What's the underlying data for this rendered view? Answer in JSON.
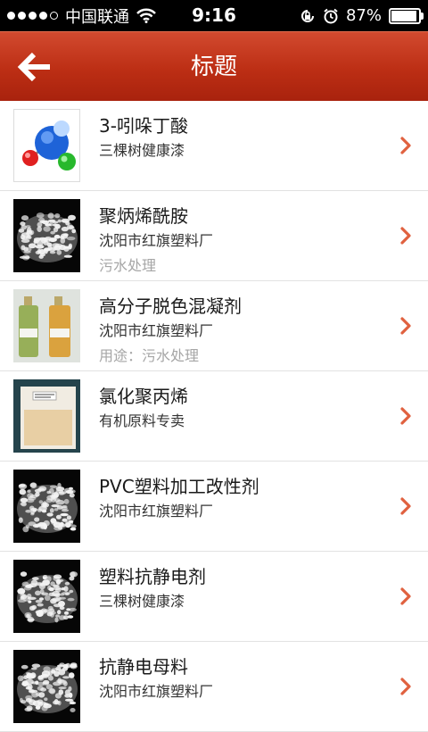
{
  "status_bar": {
    "carrier": "中国联通",
    "time": "9:16",
    "battery": "87%",
    "battery_level": 0.87,
    "icons": [
      "signal-icon",
      "wifi-icon",
      "rotation-lock-icon",
      "alarm-icon",
      "battery-icon"
    ]
  },
  "header": {
    "title": "标题",
    "back_icon": "back-arrow-icon",
    "color": "#c0391d"
  },
  "colors": {
    "accent": "#c0391d",
    "chevron": "#e0613f",
    "note_text": "#a6a6a6"
  },
  "items": [
    {
      "title": "3-吲哚丁酸",
      "subtitle": "三棵树健康漆",
      "note": "",
      "thumb": "molecule-image"
    },
    {
      "title": "聚炳烯酰胺",
      "subtitle": "沈阳市红旗塑料厂",
      "note": "污水处理",
      "thumb": "white-granules-image"
    },
    {
      "title": "高分子脱色混凝剂",
      "subtitle": "沈阳市红旗塑料厂",
      "note": "用途：污水处理",
      "thumb": "bottles-image"
    },
    {
      "title": "氯化聚丙烯",
      "subtitle": "有机原料专卖",
      "note": "",
      "thumb": "bag-image"
    },
    {
      "title": "PVC塑料加工改性剂",
      "subtitle": "沈阳市红旗塑料厂",
      "note": "",
      "thumb": "white-granules-image"
    },
    {
      "title": "塑料抗静电剂",
      "subtitle": "三棵树健康漆",
      "note": "",
      "thumb": "white-granules-image"
    },
    {
      "title": "抗静电母料",
      "subtitle": "沈阳市红旗塑料厂",
      "note": "",
      "thumb": "white-granules-image"
    }
  ]
}
